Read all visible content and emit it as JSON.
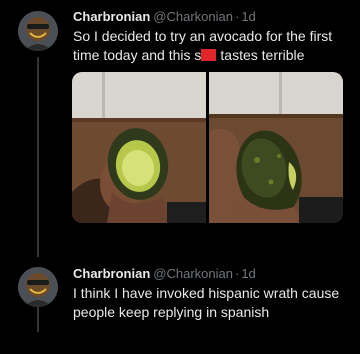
{
  "tweets": [
    {
      "name": "Charbronian",
      "handle": "@Charkonian",
      "separator": "·",
      "time": "1d",
      "text_part1": "So I decided to try an avocado for the first time today and this s",
      "text_part2": "tastes terrible",
      "media": [
        {
          "icon": "photo-avocado-cut"
        },
        {
          "icon": "photo-avocado-skin"
        }
      ]
    },
    {
      "name": "Charbronian",
      "handle": "@Charkonian",
      "separator": "·",
      "time": "1d",
      "text": "I think I have invoked hispanic wrath cause people keep replying in spanish"
    }
  ],
  "colors": {
    "background": "#000000",
    "primary_text": "#e7e9ea",
    "secondary_text": "#71767b",
    "censor_bar": "#e0262b"
  }
}
